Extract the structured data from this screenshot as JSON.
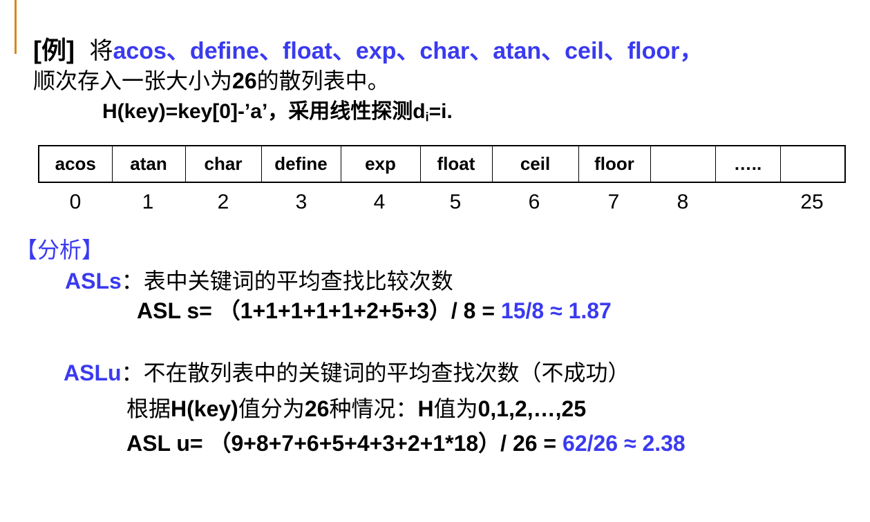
{
  "example": {
    "tag": "[例]",
    "intro": "将",
    "keywords_text": "acos、define、float、exp、char、atan、ceil、floor，",
    "line2_pre": "顺次存入一张大小为",
    "line2_num": "26",
    "line2_post": "的散列表中。",
    "hash_func": "H(key)=key[0]-’a’，采用线性探测d",
    "hash_sub": "i",
    "hash_end": "=i."
  },
  "table": {
    "cells": [
      "acos",
      "atan",
      "char",
      "define",
      "exp",
      "float",
      "ceil",
      "floor",
      "",
      "…..",
      ""
    ],
    "indices": [
      "0",
      "1",
      "2",
      "3",
      "4",
      "5",
      "6",
      "7",
      "8",
      "25"
    ]
  },
  "analysis": {
    "header": "【分析】",
    "asls_label": "ASLs",
    "asls_desc": "：表中关键词的平均查找比较次数",
    "asls_formula": "ASL s= （1+1+1+1+1+2+5+3）/ 8 = ",
    "asls_result": "15/8 ≈ 1.87",
    "aslu_label": "ASLu",
    "aslu_desc": "：不在散列表中的关键词的平均查找次数（不成功）",
    "aslu_line2_pre": "根据",
    "aslu_line2_hkey": "H(key)",
    "aslu_line2_mid": "值分为",
    "aslu_line2_num": "26",
    "aslu_line2_mid2": "种情况：",
    "aslu_line2_h": "H",
    "aslu_line2_mid3": "值为",
    "aslu_line2_vals": "0,1,2,…,25",
    "aslu_formula": "ASL u= （9+8+7+6+5+4+3+2+1*18）/ 26 = ",
    "aslu_result": "62/26 ≈ 2.38"
  },
  "colors": {
    "accent_bar": "#d9861c",
    "highlight_blue": "#3a3af0"
  }
}
